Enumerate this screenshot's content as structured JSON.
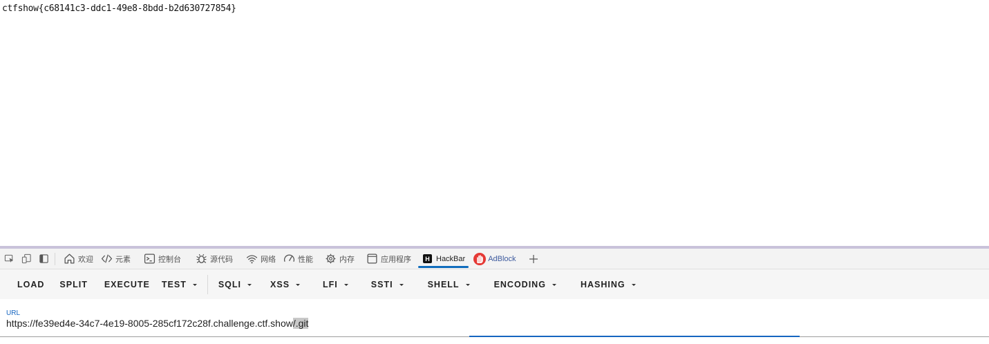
{
  "page": {
    "flag": "ctfshow{c68141c3-ddc1-49e8-8bdd-b2d630727854}"
  },
  "devtools": {
    "accent_color": "#c9c2da",
    "left_icons": [
      "inspect-element-icon",
      "device-emulation-icon",
      "dock-side-icon"
    ],
    "tabs": [
      {
        "label": "欢迎",
        "icon": "home-icon"
      },
      {
        "label": "元素",
        "icon": "code-tag-icon"
      },
      {
        "label": "控制台",
        "icon": "console-icon"
      },
      {
        "label": "源代码",
        "icon": "bug-icon"
      },
      {
        "label": "网络",
        "icon": "wifi-icon"
      },
      {
        "label": "性能",
        "icon": "speedometer-icon"
      },
      {
        "label": "内存",
        "icon": "memory-chip-icon"
      },
      {
        "label": "应用程序",
        "icon": "app-window-icon"
      },
      {
        "label": "HackBar",
        "icon": "hackbar-logo-icon",
        "active": true
      },
      {
        "label": "AdBlock",
        "icon": "adblock-hand-icon"
      }
    ],
    "add_tab_icon": "plus-icon"
  },
  "hackbar": {
    "buttons": {
      "load": "LOAD",
      "split": "SPLIT",
      "execute": "EXECUTE",
      "test": "TEST",
      "sqli": "SQLI",
      "xss": "XSS",
      "lfi": "LFI",
      "ssti": "SSTI",
      "shell": "SHELL",
      "encoding": "ENCODING",
      "hashing": "HASHING"
    },
    "url_label": "URL",
    "url_value_prefix": "https://fe39ed4e-34c7-4e19-8005-285cf172c28f.challenge.ctf.show",
    "url_value_selected": "/.git",
    "accent_color": "#1565c0"
  }
}
